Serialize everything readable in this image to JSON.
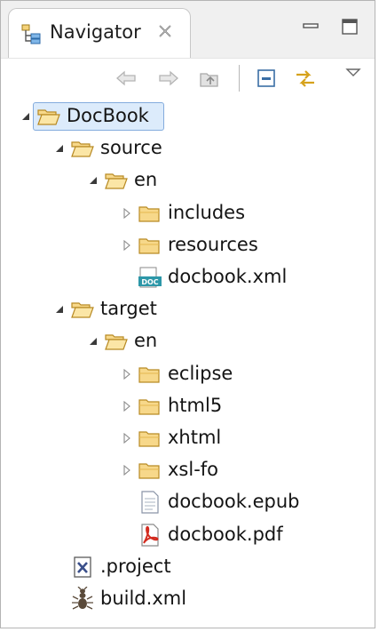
{
  "view": {
    "tab_label": "Navigator",
    "tab_icon": "navigator-icon",
    "close_icon": "close-icon",
    "minimize_icon": "minimize-icon",
    "maximize_icon": "maximize-icon"
  },
  "toolbar": {
    "back_icon": "back-arrow-icon",
    "forward_icon": "forward-arrow-icon",
    "up_icon": "go-up-folder-icon",
    "collapse_icon": "collapse-all-icon",
    "link_icon": "link-with-editor-icon",
    "menu_icon": "view-menu-icon"
  },
  "tree": [
    {
      "label": "DocBook",
      "depth": 0,
      "twisty": "expanded",
      "icon": "folder-open-icon",
      "selected": true
    },
    {
      "label": "source",
      "depth": 1,
      "twisty": "expanded",
      "icon": "folder-open-icon"
    },
    {
      "label": "en",
      "depth": 2,
      "twisty": "expanded",
      "icon": "folder-open-icon"
    },
    {
      "label": "includes",
      "depth": 3,
      "twisty": "collapsed",
      "icon": "folder-icon"
    },
    {
      "label": "resources",
      "depth": 3,
      "twisty": "collapsed",
      "icon": "folder-icon"
    },
    {
      "label": "docbook.xml",
      "depth": 3,
      "twisty": "none",
      "icon": "docbook-file-icon"
    },
    {
      "label": "target",
      "depth": 1,
      "twisty": "expanded",
      "icon": "folder-open-icon"
    },
    {
      "label": "en",
      "depth": 2,
      "twisty": "expanded",
      "icon": "folder-open-icon"
    },
    {
      "label": "eclipse",
      "depth": 3,
      "twisty": "collapsed",
      "icon": "folder-icon"
    },
    {
      "label": "html5",
      "depth": 3,
      "twisty": "collapsed",
      "icon": "folder-icon"
    },
    {
      "label": "xhtml",
      "depth": 3,
      "twisty": "collapsed",
      "icon": "folder-icon"
    },
    {
      "label": "xsl-fo",
      "depth": 3,
      "twisty": "collapsed",
      "icon": "folder-icon"
    },
    {
      "label": "docbook.epub",
      "depth": 3,
      "twisty": "none",
      "icon": "text-file-icon"
    },
    {
      "label": "docbook.pdf",
      "depth": 3,
      "twisty": "none",
      "icon": "pdf-file-icon"
    },
    {
      "label": ".project",
      "depth": 1,
      "twisty": "none",
      "icon": "xml-file-icon"
    },
    {
      "label": "build.xml",
      "depth": 1,
      "twisty": "none",
      "icon": "ant-build-icon"
    }
  ]
}
